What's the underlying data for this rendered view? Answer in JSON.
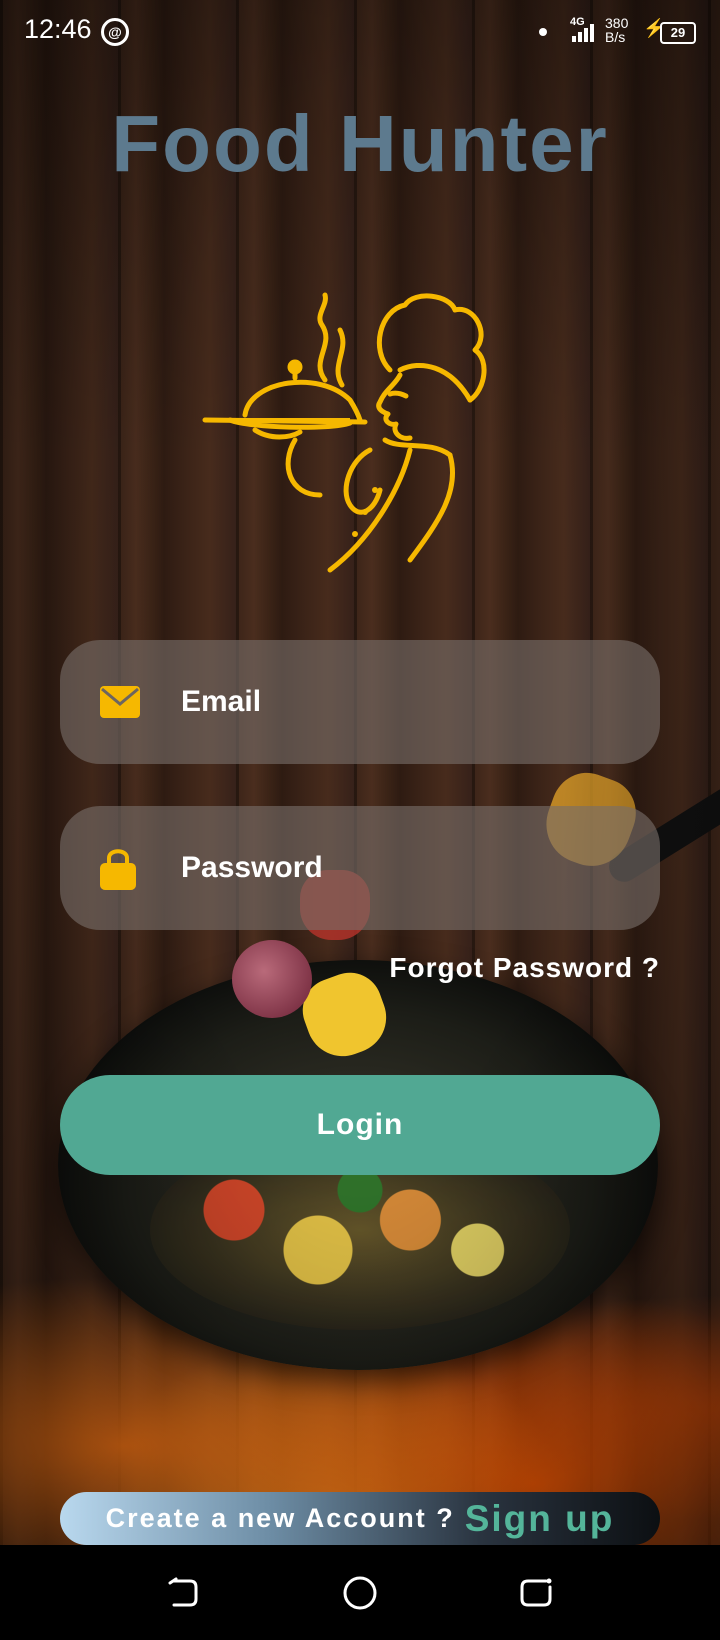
{
  "status_bar": {
    "time": "12:46",
    "network": "4G",
    "speed_value": "380",
    "speed_unit": "B/s",
    "battery": "29"
  },
  "app": {
    "title": "Food Hunter"
  },
  "login_form": {
    "email_placeholder": "Email",
    "password_placeholder": "Password",
    "forgot_password": "Forgot Password ?",
    "login_button": "Login"
  },
  "signup": {
    "prompt": "Create a new Account ?",
    "link": "Sign up"
  },
  "colors": {
    "title": "#5d7a8e",
    "accent_green": "#51a893",
    "logo_gold": "#f6b800",
    "field_bg": "rgba(120,110,105,0.62)"
  },
  "icons": {
    "email": "envelope-icon",
    "password": "lock-icon",
    "logo": "chef-serving-cloche-logo",
    "nav_back": "back-icon",
    "nav_home": "home-icon",
    "nav_recent": "recents-icon"
  }
}
